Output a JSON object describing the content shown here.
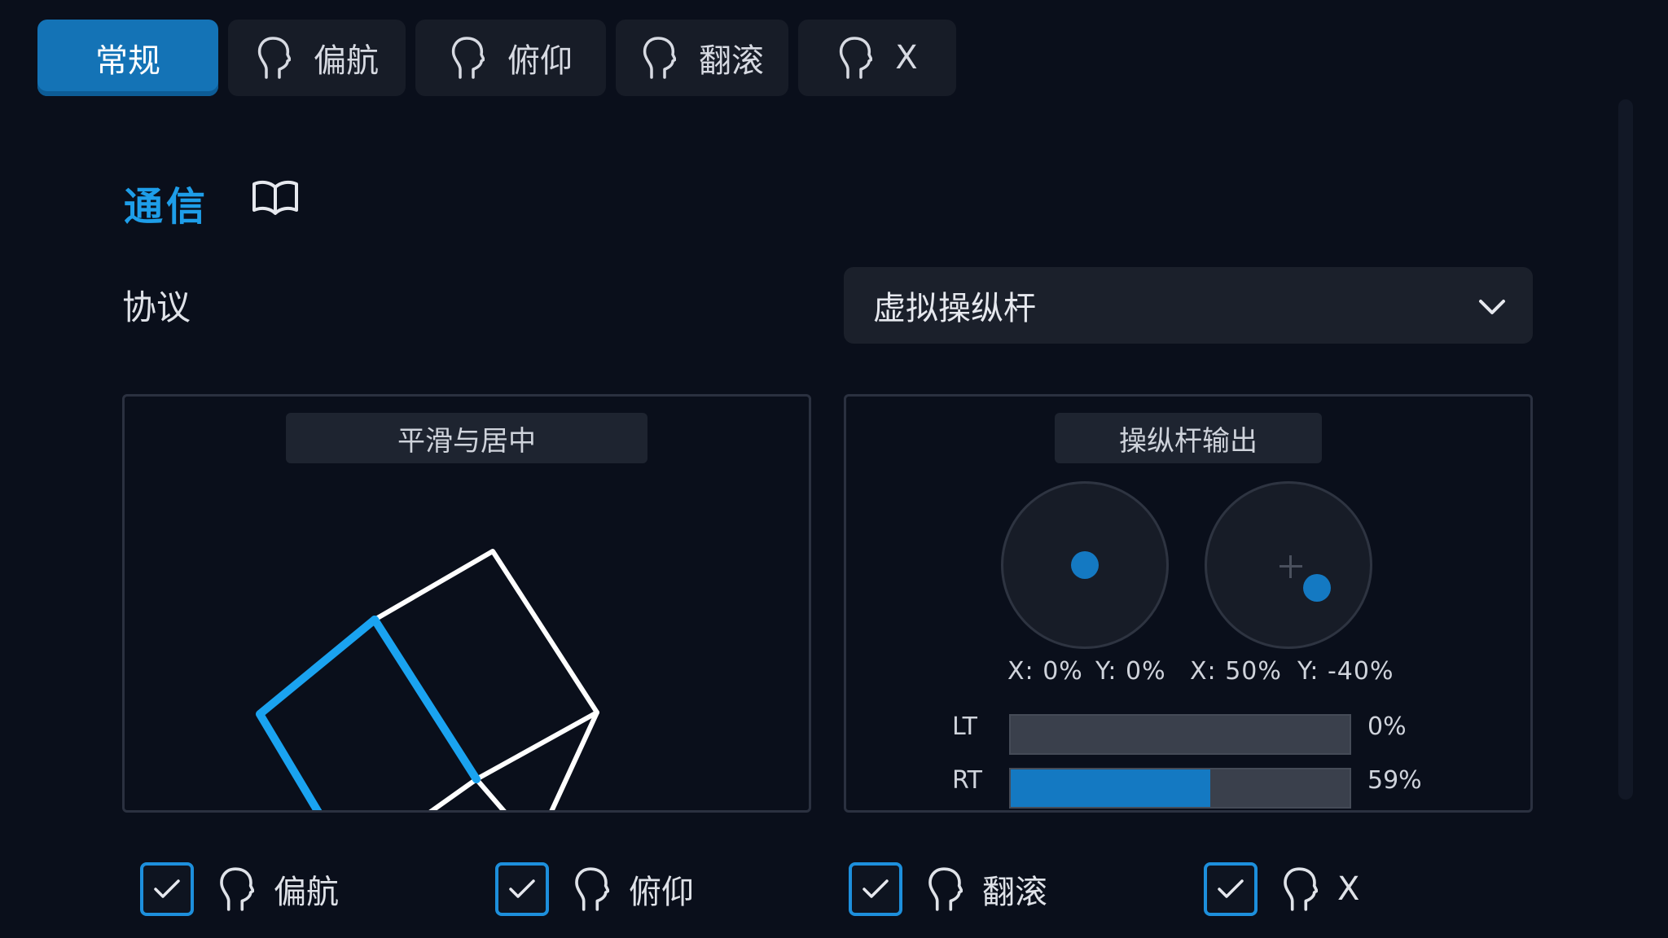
{
  "tabs": [
    {
      "label": "常规",
      "icon": null,
      "active": true
    },
    {
      "label": "偏航",
      "icon": "head-profile-icon",
      "active": false
    },
    {
      "label": "俯仰",
      "icon": "head-profile-icon",
      "active": false
    },
    {
      "label": "翻滚",
      "icon": "head-profile-icon",
      "active": false
    },
    {
      "label": "X",
      "icon": "head-profile-icon",
      "active": false
    }
  ],
  "section": {
    "title": "通信",
    "icon": "book-icon"
  },
  "protocol": {
    "label": "协议",
    "value": "虚拟操纵杆"
  },
  "smoothing_panel": {
    "title": "平滑与居中"
  },
  "output_panel": {
    "title": "操纵杆输出",
    "left_stick": {
      "x_text": "X: 0%",
      "y_text": "Y: 0%",
      "x": 0,
      "y": 0
    },
    "right_stick": {
      "x_text": "X: 50%",
      "y_text": "Y: -40%",
      "x": 0.5,
      "y": -0.4
    },
    "lt": {
      "label": "LT",
      "value_text": "0%",
      "value": 0
    },
    "rt": {
      "label": "RT",
      "value_text": "59%",
      "value": 0.59
    }
  },
  "axis_checkboxes": [
    {
      "label": "偏航",
      "checked": true
    },
    {
      "label": "俯仰",
      "checked": true
    },
    {
      "label": "翻滚",
      "checked": true
    },
    {
      "label": "X",
      "checked": true
    }
  ],
  "colors": {
    "accent": "#1473b6",
    "highlight": "#1e9ee9",
    "background": "#0a0f1b"
  }
}
